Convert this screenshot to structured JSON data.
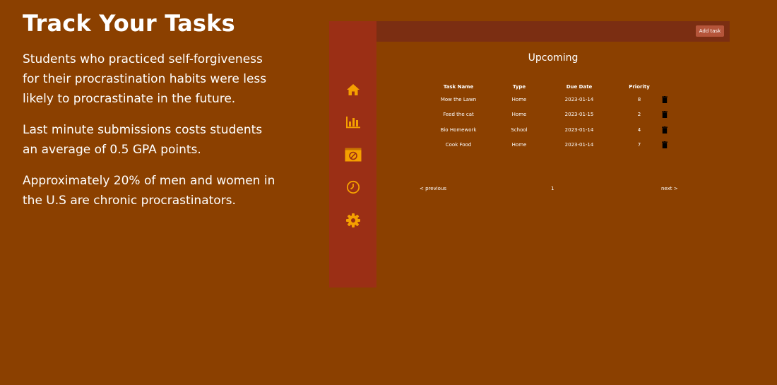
{
  "hero": {
    "title": "Track Your Tasks",
    "facts": [
      "Students who practiced self-forgiveness for their procrastination habits were less likely to procrastinate in the future.",
      "Last minute submissions costs students an average of 0.5 GPA points.",
      "Approximately 20% of men and women in the U.S are chronic procrastinators."
    ]
  },
  "colors": {
    "background": "#8b4000",
    "sidebar": "#9b2f15",
    "topbar": "#7b2e12",
    "icon": "#f5a000",
    "button": "#b5553a"
  },
  "sidebar": {
    "items": [
      {
        "icon": "home-icon"
      },
      {
        "icon": "bar-chart-icon"
      },
      {
        "icon": "block-icon"
      },
      {
        "icon": "clock-icon"
      },
      {
        "icon": "gear-icon"
      }
    ]
  },
  "topbar": {
    "add_label": "Add task"
  },
  "main": {
    "heading": "Upcoming",
    "columns": [
      "Task Name",
      "Type",
      "Due Date",
      "Priority"
    ],
    "rows": [
      {
        "name": "Mow the Lawn",
        "type": "Home",
        "due": "2023-01-14",
        "priority": "8"
      },
      {
        "name": "Feed the cat",
        "type": "Home",
        "due": "2023-01-15",
        "priority": "2"
      },
      {
        "name": "Bio Homework",
        "type": "School",
        "due": "2023-01-14",
        "priority": "4"
      },
      {
        "name": "Cook Food",
        "type": "Home",
        "due": "2023-01-14",
        "priority": "7"
      }
    ],
    "pagination": {
      "prev": "< previous",
      "page": "1",
      "next": "next >"
    }
  }
}
